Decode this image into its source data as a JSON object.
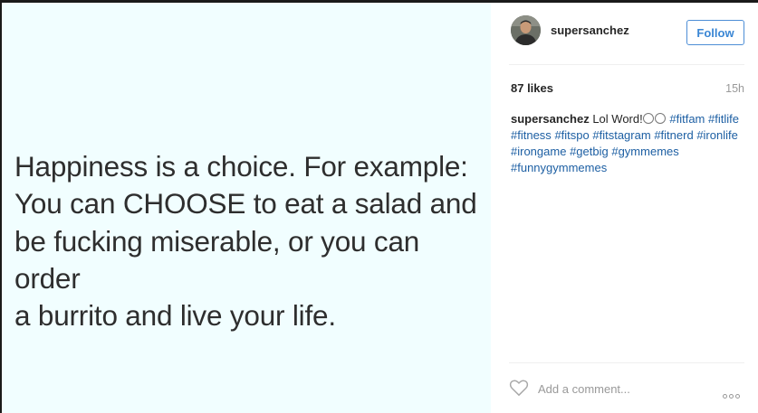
{
  "post": {
    "quote_text": "Happiness is a choice. For example:\nYou can CHOOSE to eat a salad and\nbe fucking miserable, or you can order\na burrito and live your life."
  },
  "header": {
    "username": "supersanchez",
    "follow_label": "Follow"
  },
  "stats": {
    "likes": "87 likes",
    "time_ago": "15h"
  },
  "caption": {
    "username": "supersanchez",
    "text": "Lol Word!",
    "hashtags": [
      "#fitfam",
      "#fitlife",
      "#fitness",
      "#fitspo",
      "#fitstagram",
      "#fitnerd",
      "#ironlife",
      "#irongame",
      "#getbig",
      "#gymmemes",
      "#funnygymmemes"
    ]
  },
  "comment": {
    "placeholder": "Add a comment..."
  },
  "icons": {
    "like": "heart-icon",
    "more": "more-options-icon",
    "avatar": "avatar"
  },
  "colors": {
    "image_background": "#f1feff",
    "follow_blue": "#3a86d4",
    "hashtag_blue": "#1d5fa3"
  }
}
